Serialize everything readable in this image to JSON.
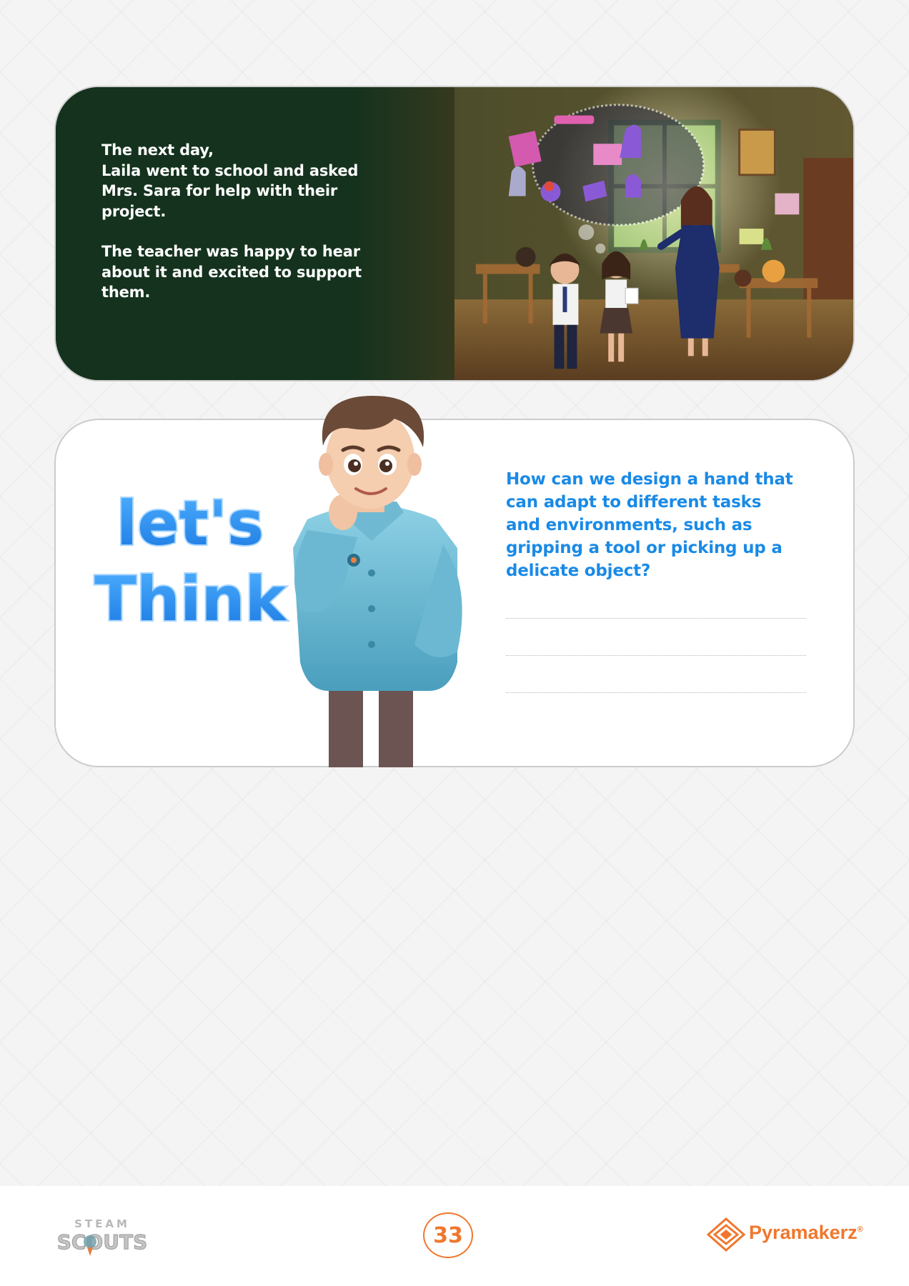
{
  "story": {
    "paragraph_1": "The next day,\nLaila went to school and asked Mrs. Sara for help with their project.",
    "paragraph_1_lines": [
      "The next day,",
      "Laila went to school and asked",
      "Mrs. Sara for help with their",
      "project."
    ],
    "paragraph_2_lines": [
      "The teacher was happy to hear",
      "about it and excited to support",
      "them."
    ]
  },
  "think": {
    "heading_line_1": "let's",
    "heading_line_2": "Think",
    "question": "How can we design a hand that can adapt to different tasks and environments, such as gripping a tool or picking up a delicate object?",
    "question_lines": [
      "How can we design a hand that",
      "can adapt to different tasks",
      "and environments, such as",
      "gripping a tool or picking up a",
      "delicate object?"
    ]
  },
  "footer": {
    "left_logo_top": "STEAM",
    "left_logo_bottom": "SCOUTS",
    "page_number": "33",
    "brand_name": "Pyramakerz",
    "brand_mark": "®"
  },
  "colors": {
    "story_bg": "#14321d",
    "question_text": "#1a8ae6",
    "heading_blue": "#2b8ef0",
    "accent_orange": "#f0772d"
  }
}
